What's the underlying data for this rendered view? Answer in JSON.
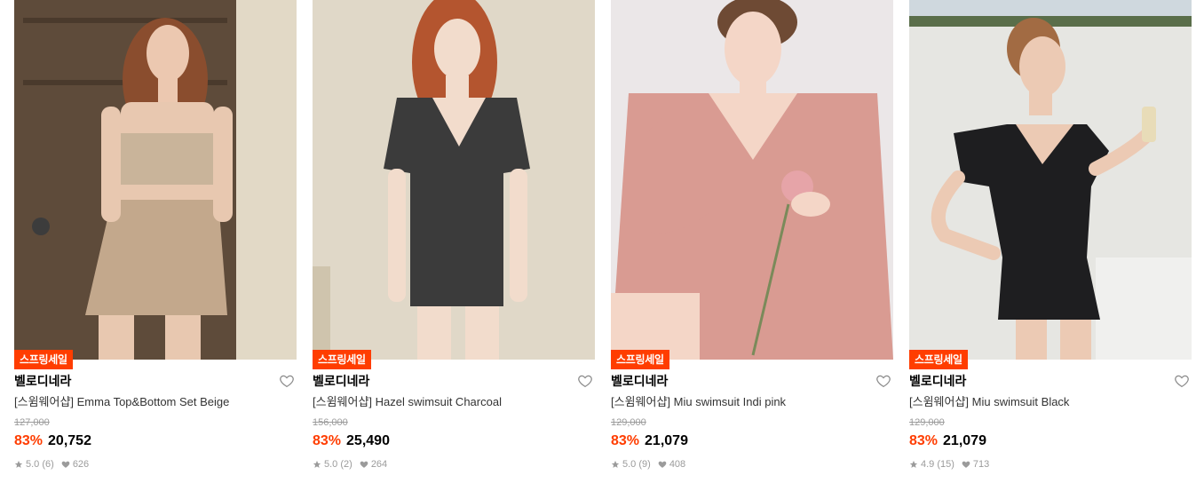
{
  "products": [
    {
      "badge": "스프링세일",
      "brand": "벨로디네라",
      "name": "[스윔웨어샵] Emma Top&Bottom Set Beige",
      "original_price": "127,000",
      "discount": "83%",
      "price": "20,752",
      "rating": "5.0",
      "reviews": "(6)",
      "likes": "626",
      "colors": {
        "bg": "#6b5a48",
        "suit": "#c8b59c",
        "skin": "#e8c8b0"
      }
    },
    {
      "badge": "스프링세일",
      "brand": "벨로디네라",
      "name": "[스윔웨어샵] Hazel swimsuit Charcoal",
      "original_price": "156,000",
      "discount": "83%",
      "price": "25,490",
      "rating": "5.0",
      "reviews": "(2)",
      "likes": "264",
      "colors": {
        "bg": "#ddd6c8",
        "suit": "#3a3a3a",
        "skin": "#f0d9c8"
      }
    },
    {
      "badge": "스프링세일",
      "brand": "벨로디네라",
      "name": "[스윔웨어샵] Miu swimsuit Indi pink",
      "original_price": "129,000",
      "discount": "83%",
      "price": "21,079",
      "rating": "5.0",
      "reviews": "(9)",
      "likes": "408",
      "colors": {
        "bg": "#e9e5e6",
        "suit": "#d99a90",
        "skin": "#f3d5c6"
      }
    },
    {
      "badge": "스프링세일",
      "brand": "벨로디네라",
      "name": "[스윔웨어샵] Miu swimsuit Black",
      "original_price": "129,000",
      "discount": "83%",
      "price": "21,079",
      "rating": "4.9",
      "reviews": "(15)",
      "likes": "713",
      "colors": {
        "bg": "#e4e6e2",
        "suit": "#1d1d1f",
        "skin": "#ecc9b3"
      }
    }
  ]
}
